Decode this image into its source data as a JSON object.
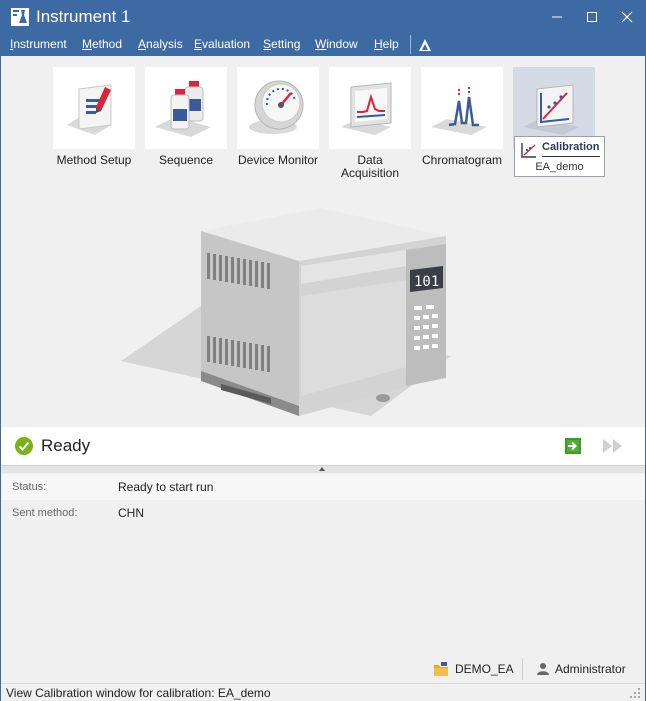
{
  "window": {
    "title": "Instrument 1",
    "accent_color": "#3e6aa3",
    "controls": {
      "minimize": "minimize-icon",
      "maximize": "maximize-icon",
      "close": "close-icon"
    }
  },
  "menu": {
    "items": [
      {
        "label": "Instrument",
        "mnemonic": "I"
      },
      {
        "label": "Method",
        "mnemonic": "M"
      },
      {
        "label": "Analysis",
        "mnemonic": "A"
      },
      {
        "label": "Evaluation",
        "mnemonic": "E"
      },
      {
        "label": "Setting",
        "mnemonic": "S"
      },
      {
        "label": "Window",
        "mnemonic": "W"
      },
      {
        "label": "Help",
        "mnemonic": "H"
      }
    ]
  },
  "toolbar": {
    "tools": [
      {
        "label": "Method Setup",
        "icon": "document-pencil-icon"
      },
      {
        "label": "Sequence",
        "icon": "sample-bottles-icon"
      },
      {
        "label": "Device Monitor",
        "icon": "gauge-icon"
      },
      {
        "label": "Data Acquisition",
        "icon": "monitor-signal-icon"
      },
      {
        "label": "Chromatogram",
        "icon": "chromatogram-peaks-icon"
      },
      {
        "label": "Calibration",
        "icon": "calibration-chart-icon",
        "active": true
      }
    ],
    "tooltip": {
      "title": "Calibration",
      "subtitle": "EA_demo"
    }
  },
  "instrument": {
    "display": "101"
  },
  "status": {
    "state": "Ready",
    "state_color": "#7ab317",
    "actions": {
      "start": "start-run-icon",
      "skip": "fast-forward-icon"
    }
  },
  "info": {
    "rows": [
      {
        "label": "Status:",
        "value": "Ready to start run"
      },
      {
        "label": "Sent method:",
        "value": "CHN"
      }
    ]
  },
  "footer": {
    "database": "DEMO_EA",
    "user": "Administrator"
  },
  "statusbar": {
    "text": "View Calibration window for calibration: EA_demo"
  }
}
